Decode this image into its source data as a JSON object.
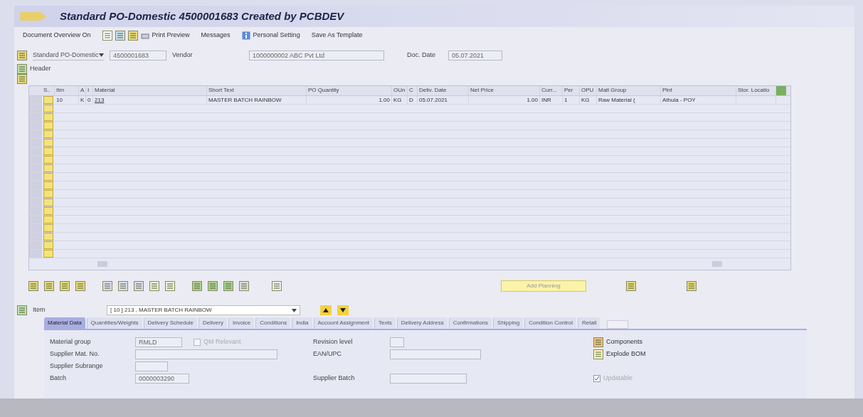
{
  "window": {
    "title": "Standard PO-Domestic 4500001683 Created by PCBDEV"
  },
  "toolbar": [
    {
      "label": "Document Overview On",
      "kind": "text"
    },
    {
      "label": "Print Preview",
      "kind": "print"
    },
    {
      "label": "Messages",
      "kind": "text"
    },
    {
      "label": "Personal Setting",
      "kind": "info"
    },
    {
      "label": "Save As Template",
      "kind": "text"
    }
  ],
  "header": {
    "doc_type": "Standard PO-Domestic",
    "doc_number": "4500001683",
    "vendor_label": "Vendor",
    "vendor": "1000000002 ABC Pvt Ltd",
    "date_label": "Doc. Date",
    "date": "05.07.2021",
    "section_label": "Header"
  },
  "table": {
    "columns": [
      "S..",
      "Itm",
      "A",
      "I",
      "Material",
      "Short Text",
      "PO Quantity",
      "OUn",
      "C",
      "Deliv. Date",
      "Net Price",
      "Curr...",
      "Per",
      "OPU",
      "Matl Group",
      "Plnt",
      "Stor. Locatio"
    ],
    "rows": [
      [
        "",
        "10",
        "K",
        "0",
        "213",
        "MASTER BATCH  RAINBOW",
        "1.00",
        "KG",
        "D",
        "05.07.2021",
        "1.00",
        "INR",
        "1",
        "KG",
        "Raw Material (",
        "Athula - POY",
        ""
      ]
    ]
  },
  "add_planning": "Add Planning",
  "item": {
    "label": "Item",
    "value": "[ 10 ] 213 , MASTER BATCH  RAINBOW"
  },
  "tabs": [
    {
      "label": "Material Data",
      "selected": true
    },
    {
      "label": "Quantities/Weights",
      "selected": false
    },
    {
      "label": "Delivery Schedule",
      "selected": false
    },
    {
      "label": "Delivery",
      "selected": false
    },
    {
      "label": "Invoice",
      "selected": false
    },
    {
      "label": "Conditions",
      "selected": false
    },
    {
      "label": "India",
      "selected": false
    },
    {
      "label": "Account Assignment",
      "selected": false
    },
    {
      "label": "Texts",
      "selected": false
    },
    {
      "label": "Delivery Address",
      "selected": false
    },
    {
      "label": "Confirmations",
      "selected": false
    },
    {
      "label": "Shipping",
      "selected": false
    },
    {
      "label": "Condition Control",
      "selected": false
    },
    {
      "label": "Retail",
      "selected": false
    }
  ],
  "detail": {
    "material_group_label": "Material group",
    "material_group": "RMLD",
    "qm": {
      "label": "QM Relevant",
      "checked": false
    },
    "revision_label": "Revision level",
    "supplier_mat_label": "Supplier Mat. No.",
    "ean_label": "EAN/UPC",
    "subrange_label": "Supplier Subrange",
    "batch_label": "Batch",
    "batch": "0000003290",
    "supplier_batch_label": "Supplier Batch",
    "components": "Components",
    "explode": "Explode BOM",
    "updatable": {
      "label": "Updatable",
      "checked": true
    }
  }
}
